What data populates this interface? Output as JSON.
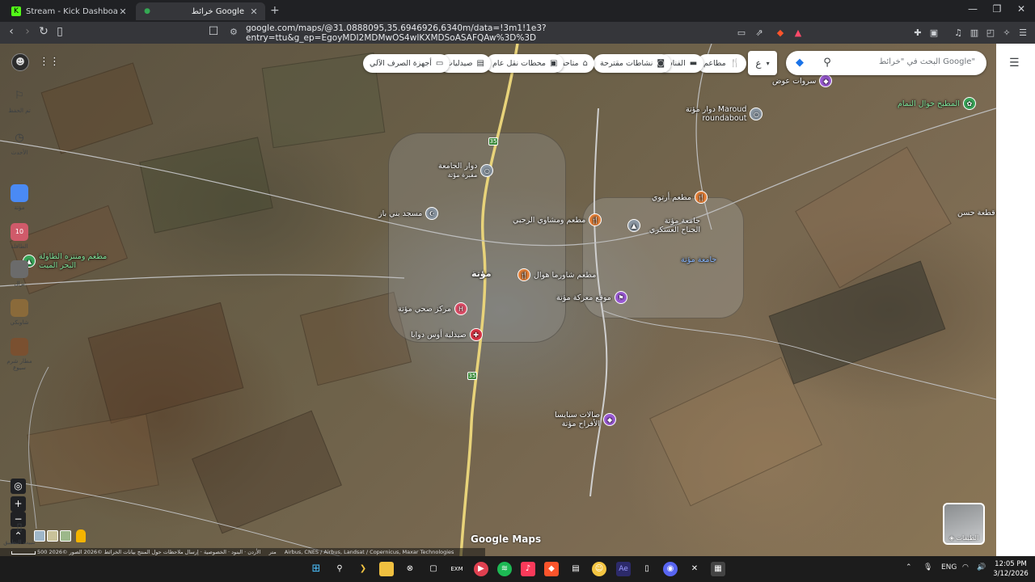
{
  "browser": {
    "tabs": [
      {
        "title": "Stream - Kick Dashboard",
        "icon": "kick-icon"
      },
      {
        "title": "خرائط Google",
        "icon": "google-maps-icon"
      }
    ],
    "url": "google.com/maps/@31.0888095,35.6946926,6340m/data=!3m1!1e3?entry=ttu&g_ep=EgoyMDI2MDMwOS4wIKXMDSoASAFQAw%3D%3D"
  },
  "maps": {
    "search_placeholder": "البحث في \"خرائط Google\"",
    "language_button": "ع",
    "chips": [
      {
        "label": "مطاعم",
        "icon": "restaurant-icon"
      },
      {
        "label": "الفنادق",
        "icon": "hotel-icon"
      },
      {
        "label": "نشاطات مقترحة",
        "icon": "camera-icon"
      },
      {
        "label": "متاحف",
        "icon": "museum-icon"
      },
      {
        "label": "محطات نقل عام",
        "icon": "transit-icon"
      },
      {
        "label": "صيدليات",
        "icon": "pharmacy-icon"
      },
      {
        "label": "أجهزة الصرف الآلي",
        "icon": "atm-icon"
      }
    ],
    "places": [
      {
        "label": "دوار مؤتة",
        "extra": "Maroud",
        "sub": "roundabout"
      },
      {
        "label": "سروات عوض"
      },
      {
        "label": "المطبخ خوال التمام"
      },
      {
        "label": "دوار الجامعة",
        "sub": "مقبرة مؤتة"
      },
      {
        "label": "مسجد بني باز"
      },
      {
        "label": "مطعم أرتوي"
      },
      {
        "label": "مطعم ومشاوي الرحبي"
      },
      {
        "label": "جامعة مؤتة الجناح العسكري"
      },
      {
        "label": "جامعة مؤتة"
      },
      {
        "label": "مطعم ومنتزه الطاولة",
        "sub": "البحر الميت"
      },
      {
        "label": "مؤتة"
      },
      {
        "label": "مطعم شاورما هوال"
      },
      {
        "label": "موقع معركة مؤتة"
      },
      {
        "label": "مركز صحي مؤتة"
      },
      {
        "label": "صيدلية أوس دوابا"
      },
      {
        "label": "صالات سبايسا",
        "sub": "الأفراح مؤتة"
      },
      {
        "label": "قطعة حسن"
      }
    ],
    "road_shield": "35",
    "logo": "Google Maps",
    "layers_label": "الطبقات",
    "attribution": "بيانات الخرائط ©2026 الصور ©2026 Airbus, CNES / Airbus, Landsat / Copernicus, Maxar Technologies",
    "attribution_links": "الأردن · البنود · الخصوصية · إرسال ملاحظات حول المنتج",
    "scale_label": "500 متر"
  },
  "sidebar": {
    "items": [
      {
        "label": "تم الحفظ",
        "icon": "bookmark-icon"
      },
      {
        "label": "الأحدث",
        "icon": "history-icon"
      },
      {
        "label": "مؤتة",
        "icon": "place-thumb-icon"
      },
      {
        "label": "الطافلة",
        "icon": "place-thumb-icon"
      },
      {
        "label": "بزال",
        "icon": "place-thumb-icon"
      },
      {
        "label": "شاوبكي",
        "icon": "place-thumb-icon"
      },
      {
        "label": "مطار شرم سيوع",
        "icon": "place-thumb-icon"
      },
      {
        "label": "تثبيت التطبيق",
        "icon": "install-app-icon"
      }
    ]
  },
  "taskbar": {
    "tray_lang": "ENG",
    "time": "12:05 PM",
    "date": "3/12/2026"
  }
}
